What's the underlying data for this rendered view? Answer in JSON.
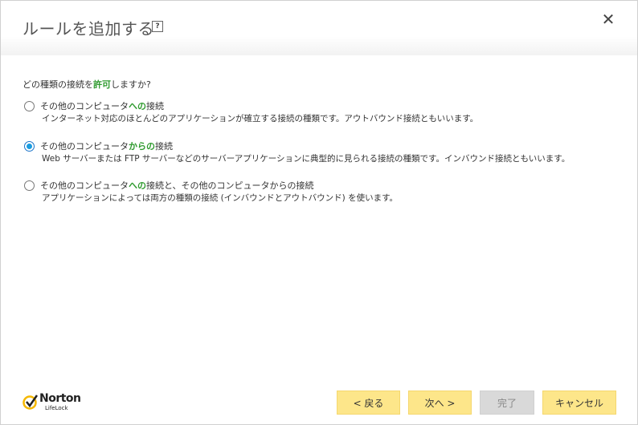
{
  "dialog": {
    "title": "ルールを追加する",
    "help_label": "?",
    "close_label": "✕"
  },
  "question": {
    "prefix": "どの種類の接続を",
    "highlight": "許可",
    "suffix": "しますか?"
  },
  "options": [
    {
      "title_prefix": "その他のコンピュータ",
      "title_highlight": "への",
      "title_suffix": "接続",
      "description": "インターネット対応のほとんどのアプリケーションが確立する接続の種類です。アウトバウンド接続ともいいます。",
      "selected": false
    },
    {
      "title_prefix": "その他のコンピュータ",
      "title_highlight": "からの",
      "title_suffix": "接続",
      "description": "Web サーバーまたは FTP サーバーなどのサーバーアプリケーションに典型的に見られる接続の種類です。インバウンド接続ともいいます。",
      "selected": true
    },
    {
      "title_prefix": "その他のコンピュータ",
      "title_highlight": "への",
      "title_suffix": "接続と、その他のコンピュータからの接続",
      "description": "アプリケーションによっては両方の種類の接続 (インバウンドとアウトバウンド) を使います。",
      "selected": false
    }
  ],
  "logo": {
    "brand": "Norton",
    "sub": "LifeLock"
  },
  "buttons": {
    "back": "< 戻る",
    "next": "次へ >",
    "finish": "完了",
    "cancel": "キャンセル"
  },
  "colors": {
    "accent_green": "#2e9a2e",
    "button_yellow": "#fde68a",
    "radio_blue": "#1a9ce0",
    "disabled_gray": "#d9d9d9"
  }
}
